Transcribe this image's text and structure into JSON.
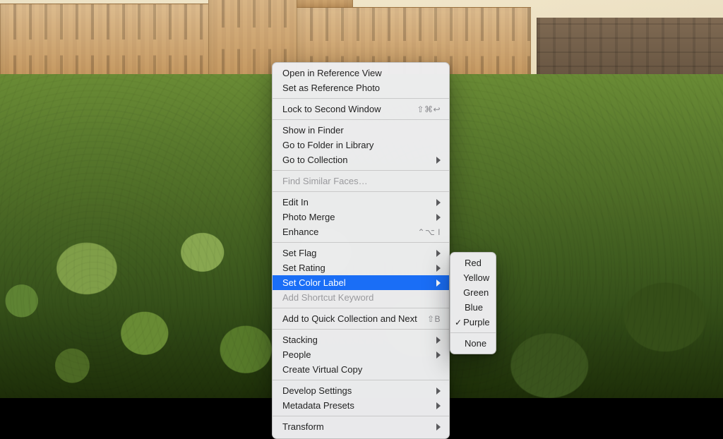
{
  "menu": {
    "groups": [
      [
        {
          "label": "Open in Reference View"
        },
        {
          "label": "Set as Reference Photo"
        }
      ],
      [
        {
          "label": "Lock to Second Window",
          "shortcut": "⇧⌘↩"
        }
      ],
      [
        {
          "label": "Show in Finder"
        },
        {
          "label": "Go to Folder in Library"
        },
        {
          "label": "Go to Collection",
          "submenu": true
        }
      ],
      [
        {
          "label": "Find Similar Faces…",
          "disabled": true
        }
      ],
      [
        {
          "label": "Edit In",
          "submenu": true
        },
        {
          "label": "Photo Merge",
          "submenu": true
        },
        {
          "label": "Enhance",
          "shortcut": "⌃⌥ I"
        }
      ],
      [
        {
          "label": "Set Flag",
          "submenu": true
        },
        {
          "label": "Set Rating",
          "submenu": true
        },
        {
          "label": "Set Color Label",
          "submenu": true,
          "selected": true
        },
        {
          "label": "Add Shortcut Keyword",
          "disabled": true
        }
      ],
      [
        {
          "label": "Add to Quick Collection and Next",
          "shortcut": "⇧B"
        }
      ],
      [
        {
          "label": "Stacking",
          "submenu": true
        },
        {
          "label": "People",
          "submenu": true
        },
        {
          "label": "Create Virtual Copy"
        }
      ],
      [
        {
          "label": "Develop Settings",
          "submenu": true
        },
        {
          "label": "Metadata Presets",
          "submenu": true
        }
      ],
      [
        {
          "label": "Transform",
          "submenu": true
        }
      ]
    ]
  },
  "submenu": {
    "items": [
      {
        "label": "Red"
      },
      {
        "label": "Yellow"
      },
      {
        "label": "Green"
      },
      {
        "label": "Blue"
      },
      {
        "label": "Purple",
        "checked": true
      }
    ],
    "footer": {
      "label": "None"
    }
  }
}
